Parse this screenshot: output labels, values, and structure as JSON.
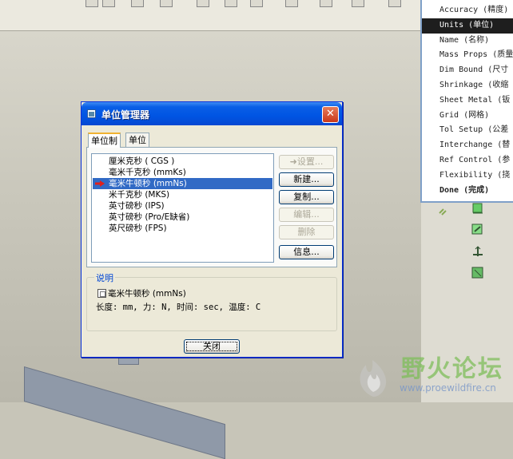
{
  "dialog": {
    "title": "单位管理器",
    "close_glyph": "✕",
    "tabs": [
      {
        "label": "单位制"
      },
      {
        "label": "单位"
      }
    ],
    "systems": [
      {
        "label": "厘米克秒 ( CGS )"
      },
      {
        "label": "毫米千克秒 (mmKs)"
      },
      {
        "label": "毫米牛顿秒 (mmNs)"
      },
      {
        "label": "米千克秒 (MKS)"
      },
      {
        "label": "英寸磅秒 (IPS)"
      },
      {
        "label": "英寸磅秒 (Pro/E缺省)"
      },
      {
        "label": "英尺磅秒 (FPS)"
      }
    ],
    "selected_index": 2,
    "buttons": {
      "set": "➜设置...",
      "new": "新建...",
      "copy": "复制...",
      "edit": "编辑...",
      "delete": "删除",
      "info": "信息..."
    },
    "description": {
      "title": "说明",
      "name": "毫米牛顿秒 (mmNs)",
      "detail": "长度: mm, 力: N, 时间: sec, 温度: C"
    },
    "close_label": "关闭"
  },
  "menu": {
    "items": [
      {
        "label": "Accuracy (精度)"
      },
      {
        "label": "Units (单位)"
      },
      {
        "label": "Name (名称)"
      },
      {
        "label": "Mass Props (质量"
      },
      {
        "label": "Dim Bound (尺寸"
      },
      {
        "label": "Shrinkage (收缩"
      },
      {
        "label": "Sheet Metal (钣"
      },
      {
        "label": "Grid (网格)"
      },
      {
        "label": "Tol Setup (公差"
      },
      {
        "label": "Interchange (替"
      },
      {
        "label": "Ref Control (参"
      },
      {
        "label": "Flexibility (挠"
      },
      {
        "label": "Done (完成)"
      }
    ],
    "selected_index": 1
  },
  "watermark": {
    "text": "野火论坛",
    "url": "www.proewildfire.cn"
  },
  "colors": {
    "accent": "#0054e3",
    "selection": "#316ac5",
    "menu_selection": "#1e1e1e"
  }
}
